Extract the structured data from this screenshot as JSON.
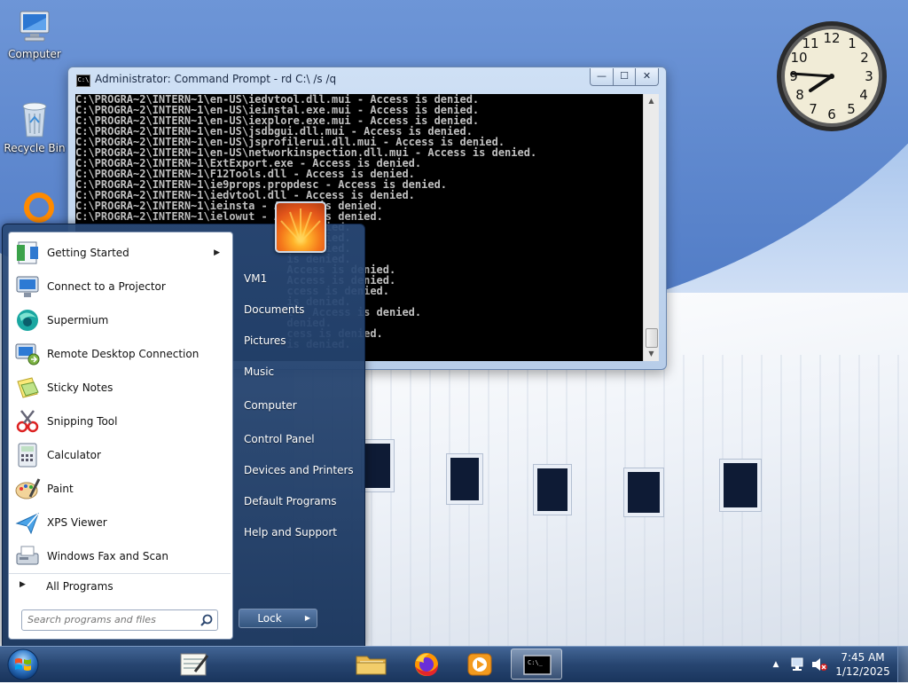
{
  "desktop": {
    "icons": [
      {
        "label": "Computer",
        "icon": "computer-icon"
      },
      {
        "label": "Recycle Bin",
        "icon": "recycle-bin-icon"
      }
    ]
  },
  "cmd_window": {
    "title": "Administrator: Command Prompt - rd  C:\\ /s /q",
    "title_icon_text": "C:\\",
    "minimize": "—",
    "maximize": "☐",
    "close": "✕",
    "lines": [
      "C:\\PROGRA~2\\INTERN~1\\en-US\\iedvtool.dll.mui - Access is denied.",
      "C:\\PROGRA~2\\INTERN~1\\en-US\\ieinstal.exe.mui - Access is denied.",
      "C:\\PROGRA~2\\INTERN~1\\en-US\\iexplore.exe.mui - Access is denied.",
      "C:\\PROGRA~2\\INTERN~1\\en-US\\jsdbgui.dll.mui - Access is denied.",
      "C:\\PROGRA~2\\INTERN~1\\en-US\\jsprofilerui.dll.mui - Access is denied.",
      "C:\\PROGRA~2\\INTERN~1\\en-US\\networkinspection.dll.mui - Access is denied.",
      "C:\\PROGRA~2\\INTERN~1\\ExtExport.exe - Access is denied.",
      "C:\\PROGRA~2\\INTERN~1\\F12Tools.dll - Access is denied.",
      "C:\\PROGRA~2\\INTERN~1\\ie9props.propdesc - Access is denied.",
      "C:\\PROGRA~2\\INTERN~1\\iedvtool.dll - Access is denied.",
      "C:\\PROGRA~2\\INTERN~1\\ieinsta",
      "C:\\PROGRA~2\\INTERN~1\\ielowut",
      "                                 is denied.",
      "                                 is denied.",
      "                                 is denied.",
      "                                 is denied.",
      "                                 Access is denied.",
      "                                 Access is denied.",
      "                                 ccess is denied.",
      "                                 is denied.",
      "                                 l - Access is denied.",
      "                                 denied.",
      "                                 cess is denied.",
      "                                 is denied."
    ],
    "line_tails": {
      "10": " - Access is denied.",
      "11": " - Access is denied."
    }
  },
  "start_menu": {
    "programs": [
      {
        "label": "Getting Started",
        "icon": "getting-started-icon",
        "has_submenu": true
      },
      {
        "label": "Connect to a Projector",
        "icon": "projector-icon"
      },
      {
        "label": "Supermium",
        "icon": "supermium-icon"
      },
      {
        "label": "Remote Desktop Connection",
        "icon": "remote-desktop-icon"
      },
      {
        "label": "Sticky Notes",
        "icon": "sticky-notes-icon"
      },
      {
        "label": "Snipping Tool",
        "icon": "snipping-tool-icon"
      },
      {
        "label": "Calculator",
        "icon": "calculator-icon"
      },
      {
        "label": "Paint",
        "icon": "paint-icon"
      },
      {
        "label": "XPS Viewer",
        "icon": "xps-viewer-icon"
      },
      {
        "label": "Windows Fax and Scan",
        "icon": "fax-scan-icon"
      }
    ],
    "all_programs": "All Programs",
    "search_placeholder": "Search programs and files",
    "right_items": [
      {
        "label": "VM1"
      },
      {
        "label": "Documents"
      },
      {
        "label": "Pictures"
      },
      {
        "label": "Music"
      },
      {
        "label": "Computer"
      },
      {
        "label": "Control Panel"
      },
      {
        "label": "Devices and Printers"
      },
      {
        "label": "Default Programs"
      },
      {
        "label": "Help and Support"
      }
    ],
    "lock_label": "Lock",
    "lock_arrow": "▶"
  },
  "taskbar": {
    "pinned": [
      {
        "name": "notepad-taskbar-icon"
      },
      {
        "name": "explorer-taskbar-icon"
      },
      {
        "name": "firefox-taskbar-icon"
      },
      {
        "name": "media-player-taskbar-icon"
      },
      {
        "name": "cmd-taskbar-icon",
        "active": true
      }
    ],
    "tray_arrow": "▲",
    "time": "7:45 AM",
    "date": "1/12/2025"
  },
  "colors": {
    "taskbar": "#2a4a7a",
    "console_bg": "#000000",
    "console_text": "#c0c0c0",
    "start_menu_left": "#ffffff"
  }
}
